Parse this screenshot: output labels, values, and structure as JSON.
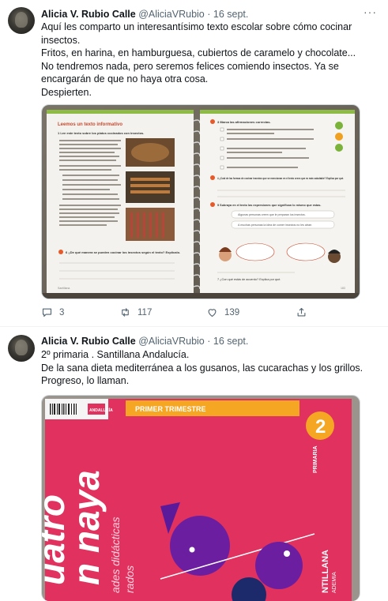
{
  "tweet1": {
    "name": "Alicia V. Rubio Calle",
    "handle": "@AliciaVRubio",
    "separator": "·",
    "date": "16 sept.",
    "more": "···",
    "lines": [
      "Aquí les comparto un interesantísimo texto escolar sobre cómo cocinar",
      "insectos.",
      "Fritos, en harina, en hamburguesa, cubiertos de caramelo y chocolate...",
      "No tendremos nada, pero seremos felices comiendo insectos. Ya se",
      "encargarán de que no haya otra cosa.",
      "Despierten."
    ],
    "image": {
      "left_title": "Leemos un texto informativo",
      "left_q1": "1 Lee este texto sobre los platos cocinados con insectos.",
      "left_q6": "6 ¿De qué manera se pueden cocinar los insectos según el texto? Explícalo.",
      "right_q3": "3 Marca las afirmaciones correctas.",
      "right_q4": "4 ¿Cuál de las formas de cocinar insectos que se mencionan en el texto crees que es más saludable? Explica por qué.",
      "right_q5": "5 Subraya en el texto las expresiones que significan lo mismo que estas.",
      "option_1": "Algunas personas creen que le preparan los insectos.",
      "option_2": "A muchas personas la idea de comer insectos no les atrae.",
      "right_q7": "7 ¿Con qué estás de acuerdo? Explica por qué.",
      "footer_left": "Santillana",
      "footer_right": "183"
    },
    "stats": {
      "replies": "3",
      "retweets": "117",
      "likes": "139"
    }
  },
  "tweet2": {
    "name": "Alicia V. Rubio Calle",
    "handle": "@AliciaVRubio",
    "separator": "·",
    "date": "16 sept.",
    "lines": [
      "2º primaria . Santillana Andalucía.",
      "De la sana dieta mediterránea a los gusanos, las cucarachas y los grillos.",
      "Progreso, lo llaman."
    ],
    "image": {
      "banner": "PRIMER TRIMESTRE",
      "region": "ANDALUCÍA",
      "level": "PRIMARIA",
      "grade": "2",
      "title_line1": "uatro",
      "title_line2": "n naya",
      "subtitle_line1": "ades didácticas",
      "subtitle_line2": "rados",
      "publisher": "NTILLANA",
      "publisher_sub": "ADEMIA"
    }
  },
  "colors": {
    "text": "#0f1419",
    "muted": "#536471",
    "cover_pink": "#e0315f",
    "cover_orange": "#f5a623",
    "page_red": "#c94a2e",
    "page_green": "#7bb23a"
  }
}
